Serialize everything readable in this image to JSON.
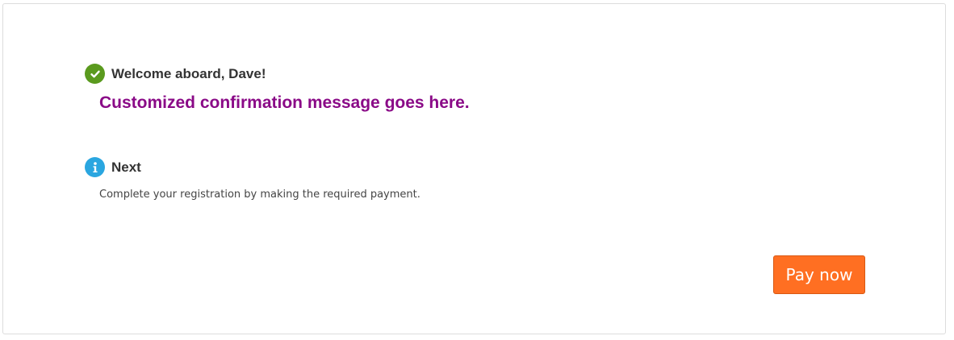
{
  "welcome": {
    "icon": "check-circle-icon",
    "icon_color": "#5a9a1e",
    "title": "Welcome aboard, Dave!",
    "message": "Customized confirmation message goes here.",
    "message_color": "#8a0a87"
  },
  "next": {
    "icon": "info-circle-icon",
    "icon_color": "#2aa6e0",
    "title": "Next",
    "description": "Complete your registration by making the required payment."
  },
  "actions": {
    "pay_label": "Pay now",
    "pay_color": "#ff6f22"
  }
}
